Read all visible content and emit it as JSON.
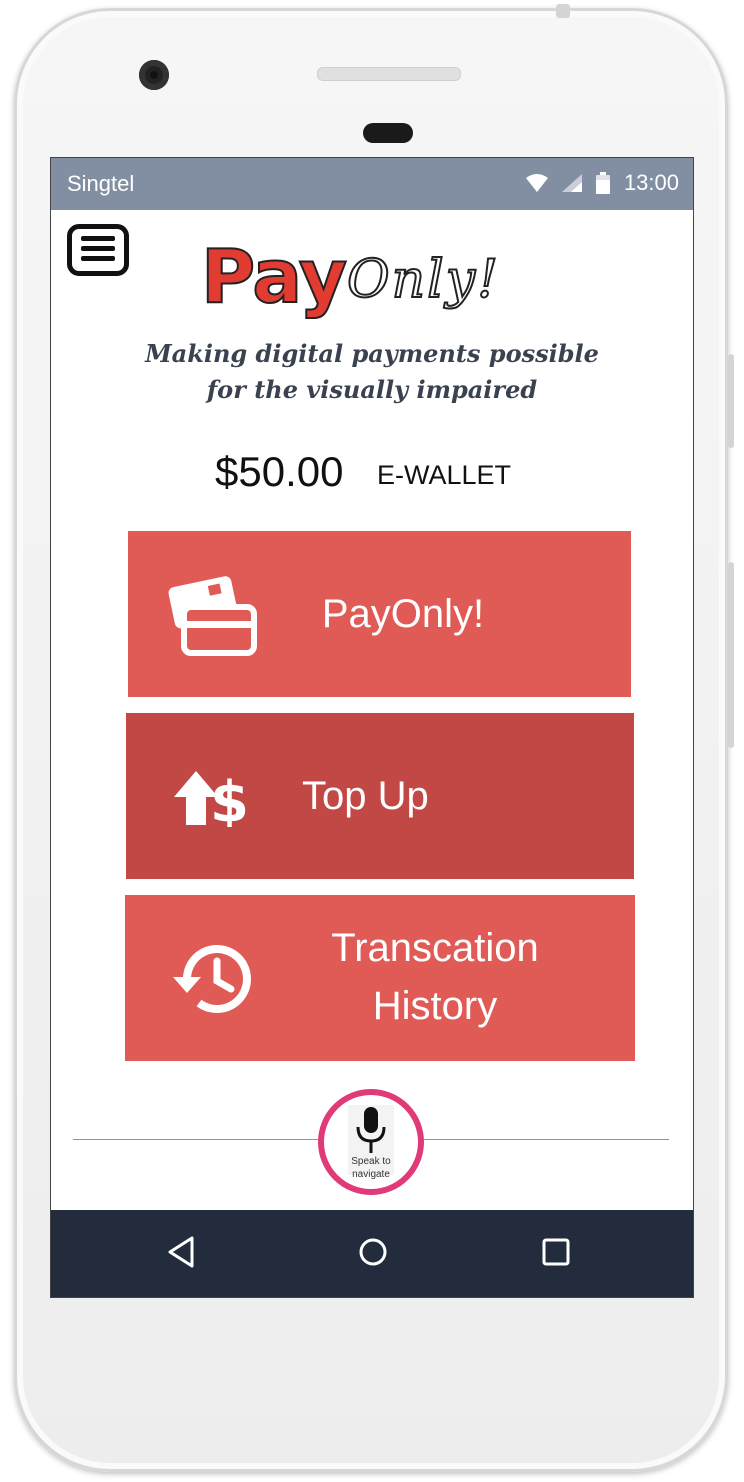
{
  "status_bar": {
    "carrier": "Singtel",
    "time": "13:00",
    "icons": [
      "wifi-icon",
      "signal-icon",
      "battery-icon"
    ]
  },
  "header": {
    "menu_icon": "hamburger-menu-icon",
    "logo_pay": "Pay",
    "logo_only": "Only!",
    "tagline_line1": "Making digital payments possible",
    "tagline_line2": "for the visually impaired"
  },
  "wallet": {
    "balance": "$50.00",
    "label": "E-WALLET"
  },
  "actions": [
    {
      "label": "PayOnly!",
      "icon": "credit-cards-icon",
      "color": "#e05a56"
    },
    {
      "label": "Top Up",
      "icon": "top-up-dollar-icon",
      "color": "#c24846"
    },
    {
      "label_line1": "Transcation",
      "label_line2": "History",
      "icon": "history-clock-icon",
      "color": "#e05a56"
    }
  ],
  "voice": {
    "icon": "microphone-icon",
    "caption_line1": "Speak to",
    "caption_line2": "navigate",
    "ring_color": "#e03a78"
  },
  "nav_bar": {
    "items": [
      "back-icon",
      "home-icon",
      "recents-icon"
    ]
  }
}
